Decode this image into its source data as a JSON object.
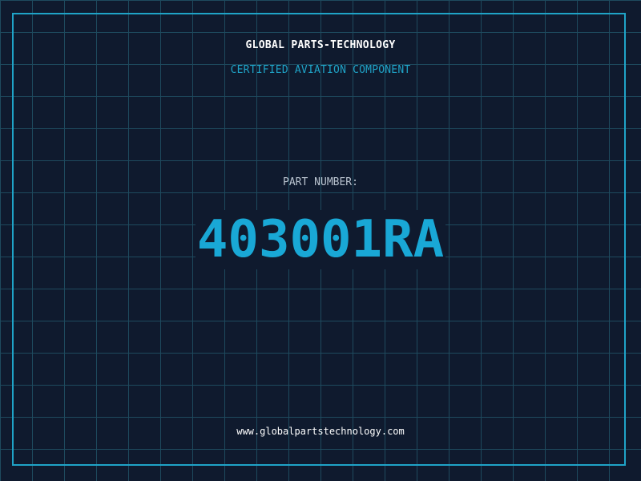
{
  "header": {
    "company": "GLOBAL PARTS-TECHNOLOGY",
    "subtitle": "CERTIFIED AVIATION COMPONENT"
  },
  "part": {
    "label": "PART NUMBER:",
    "number": "403001RA"
  },
  "footer": {
    "website": "www.globalpartstechnology.com"
  },
  "colors": {
    "background": "#0f1a2e",
    "grid": "#1e4a5e",
    "accent": "#1fa3c7",
    "part_number": "#19a8d6",
    "text": "#ffffff",
    "label": "#b9c3cf"
  }
}
